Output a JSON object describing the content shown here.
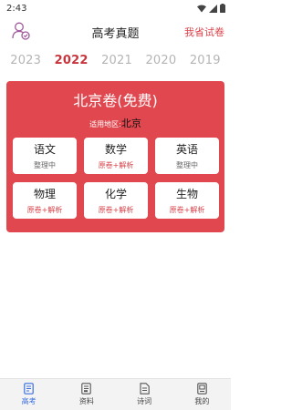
{
  "status_bar": {
    "time": "2:43"
  },
  "header": {
    "title": "高考真题",
    "right_link": "我省试卷"
  },
  "years": [
    {
      "label": "2023",
      "active": false
    },
    {
      "label": "2022",
      "active": true
    },
    {
      "label": "2021",
      "active": false
    },
    {
      "label": "2020",
      "active": false
    },
    {
      "label": "2019",
      "active": false
    }
  ],
  "card": {
    "title": "北京卷(免费)",
    "region_label": "适用地区:",
    "region_value": "北京",
    "subjects": [
      {
        "name": "语文",
        "status": "整理中",
        "available": false
      },
      {
        "name": "数学",
        "status": "原卷+解析",
        "available": true
      },
      {
        "name": "英语",
        "status": "整理中",
        "available": false
      },
      {
        "name": "物理",
        "status": "原卷+解析",
        "available": true
      },
      {
        "name": "化学",
        "status": "原卷+解析",
        "available": true
      },
      {
        "name": "生物",
        "status": "原卷+解析",
        "available": true
      }
    ]
  },
  "tabs": [
    {
      "label": "高考",
      "icon": "exam-doc-icon",
      "active": true
    },
    {
      "label": "资料",
      "icon": "materials-icon",
      "active": false
    },
    {
      "label": "诗词",
      "icon": "poetry-icon",
      "active": false
    },
    {
      "label": "我的",
      "icon": "profile-icon",
      "active": false
    }
  ],
  "colors": {
    "accent": "#e0474e",
    "tab_active": "#3d6fe0"
  }
}
